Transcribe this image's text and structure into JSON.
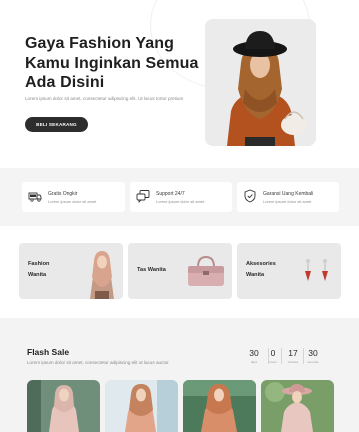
{
  "hero": {
    "title": "Gaya Fashion Yang Kamu Inginkan Semua Ada Disini",
    "description": "Lorem ipsum dolor sit amet, consectetur adipiscing elit. Ut lacus tortor pretium",
    "button_label": "BELI SEKARANG"
  },
  "features": [
    {
      "title": "Gratis Ongkir",
      "desc": "Lorem ipsum dolor sit amet",
      "icon": "truck-icon"
    },
    {
      "title": "Support 24/7",
      "desc": "Lorem ipsum dolor sit amet",
      "icon": "chat-icon"
    },
    {
      "title": "Garansi Uang Kembali",
      "desc": "Lorem ipsum dolor sit amet",
      "icon": "shield-icon"
    }
  ],
  "categories": [
    {
      "line1": "Fashion",
      "line2": "Wanita"
    },
    {
      "line1": "Tas Wanita",
      "line2": ""
    },
    {
      "line1": "Aksesories",
      "line2": "Wanita"
    }
  ],
  "flash_sale": {
    "title": "Flash Sale",
    "description": "Lorem ipsum dolor sit amet, consectetur adipiscing elit ut lacus auctor",
    "countdown": [
      {
        "value": "30",
        "unit": "days"
      },
      {
        "value": "0",
        "unit": "hours"
      },
      {
        "value": "17",
        "unit": "minutes"
      },
      {
        "value": "30",
        "unit": "seconds"
      }
    ]
  },
  "colors": {
    "accent_dark": "#2d2d2d",
    "hijab_brown": "#a5652f",
    "section_bg": "#f4f4f4"
  }
}
